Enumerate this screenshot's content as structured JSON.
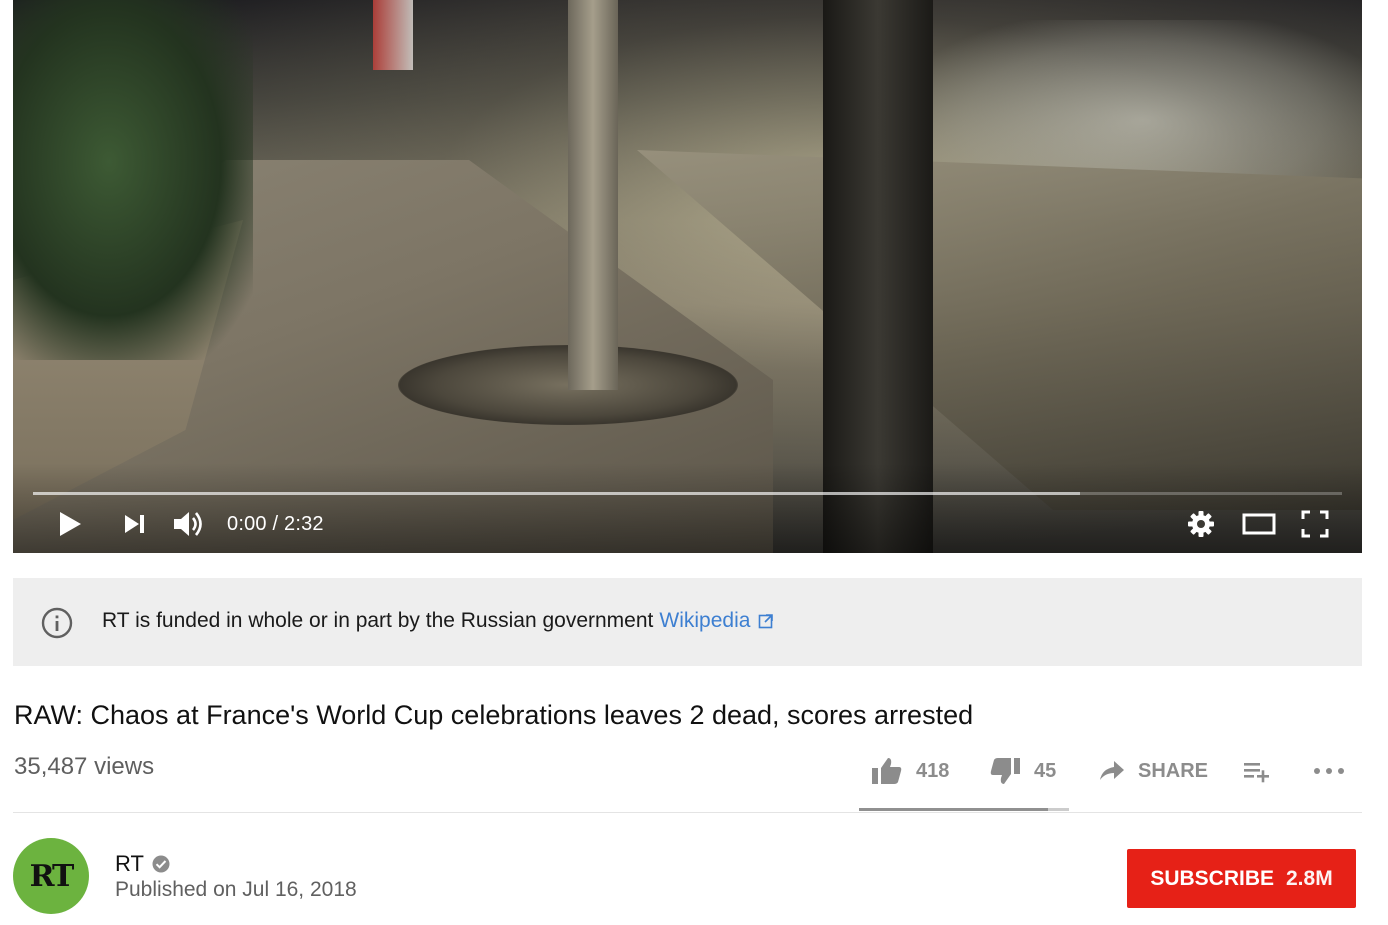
{
  "player": {
    "time_current": "0:00",
    "time_separator": " / ",
    "time_total": "2:32",
    "progress_played_fraction": 0.0,
    "progress_buffered_fraction": 0.8,
    "controls": [
      "play-icon",
      "next-icon",
      "volume-icon",
      "settings-icon",
      "theater-icon",
      "fullscreen-icon"
    ]
  },
  "banner": {
    "text": "RT is funded in whole or in part by the Russian government",
    "link_label": "Wikipedia",
    "icons": [
      "info-icon",
      "external-link-icon"
    ]
  },
  "video": {
    "title": "RAW: Chaos at France's World Cup celebrations leaves 2 dead, scores arrested",
    "views": "35,487 views"
  },
  "actions": {
    "like_count": "418",
    "dislike_count": "45",
    "share_label": "SHARE",
    "like_ratio": 0.9,
    "icons": [
      "thumbs-up-icon",
      "thumbs-down-icon",
      "share-icon",
      "add-to-playlist-icon",
      "more-icon"
    ]
  },
  "channel": {
    "avatar_text": "RT",
    "name": "RT",
    "published": "Published on Jul 16, 2018",
    "verified": true
  },
  "subscribe": {
    "label": "SUBSCRIBE",
    "count": "2.8M"
  },
  "colors": {
    "subscribe_bg": "#e62117",
    "link": "#3d7fd1",
    "avatar_bg": "#6cb33f",
    "banner_bg": "#eeeeee"
  }
}
